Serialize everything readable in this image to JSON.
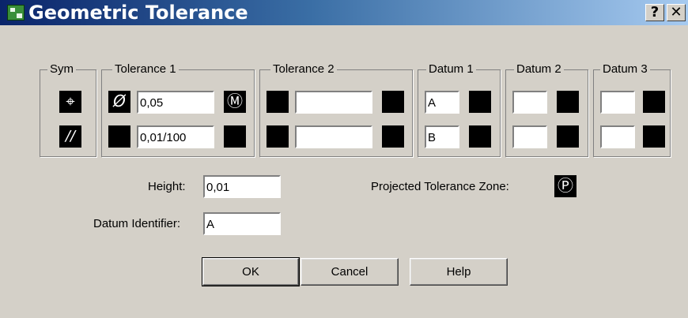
{
  "window": {
    "title": "Geometric Tolerance",
    "help_label": "?",
    "close_label": "✕"
  },
  "groups": {
    "sym": "Sym",
    "tolerance1": "Tolerance 1",
    "tolerance2": "Tolerance 2",
    "datum1": "Datum 1",
    "datum2": "Datum 2",
    "datum3": "Datum 3"
  },
  "sym": {
    "row1_symbol": "⌖",
    "row2_symbol": "//"
  },
  "tolerance1": {
    "row1": {
      "diameter_symbol": "Ø",
      "value": "0,05",
      "material_condition": "Ⓜ"
    },
    "row2": {
      "diameter_symbol": "",
      "value": "0,01/100",
      "material_condition": ""
    }
  },
  "tolerance2": {
    "row1": {
      "value": ""
    },
    "row2": {
      "value": ""
    }
  },
  "datum1": {
    "row1": "A",
    "row2": "B"
  },
  "datum2": {
    "row1": "",
    "row2": ""
  },
  "datum3": {
    "row1": "",
    "row2": ""
  },
  "height": {
    "label": "Height:",
    "value": "0,01"
  },
  "projected_zone": {
    "label": "Projected Tolerance Zone:",
    "symbol": "Ⓟ"
  },
  "datum_identifier": {
    "label": "Datum Identifier:",
    "value": "A"
  },
  "buttons": {
    "ok": "OK",
    "cancel": "Cancel",
    "help": "Help"
  }
}
